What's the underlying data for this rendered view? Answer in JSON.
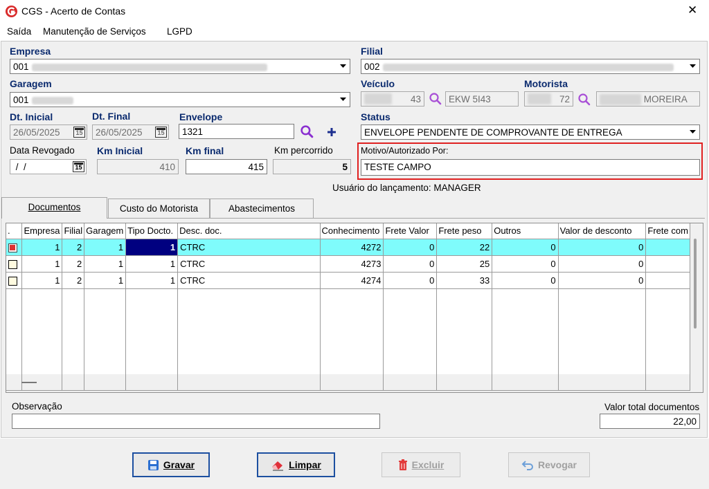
{
  "window": {
    "title": "CGS - Acerto de Contas"
  },
  "menu": [
    "Saída",
    "Manutenção de Serviços",
    "LGPD"
  ],
  "form": {
    "empresa_label": "Empresa",
    "empresa_value": "001",
    "filial_label": "Filial",
    "filial_value": "002",
    "garagem_label": "Garagem",
    "garagem_value": "001",
    "veiculo_label": "Veículo",
    "veiculo_code": "43",
    "veiculo_plate": "EKW 5I43",
    "motorista_label": "Motorista",
    "motorista_code": "72",
    "motorista_name": "MOREIRA",
    "dt_inicial_label": "Dt. Inicial",
    "dt_inicial_value": "26/05/2025",
    "dt_final_label": "Dt. Final",
    "dt_final_value": "26/05/2025",
    "envelope_label": "Envelope",
    "envelope_value": "1321",
    "status_label": "Status",
    "status_value": "ENVELOPE PENDENTE DE COMPROVANTE DE ENTREGA",
    "data_revogado_label": "Data Revogado",
    "data_revogado_value": " /  /",
    "km_inicial_label": "Km Inicial",
    "km_inicial_value": "410",
    "km_final_label": "Km final",
    "km_final_value": "415",
    "km_percorrido_label": "Km percorrido",
    "km_percorrido_value": "5",
    "motivo_label": "Motivo/Autorizado Por:",
    "motivo_value": "TESTE CAMPO",
    "usuario_text": "Usuário do lançamento: MANAGER",
    "calendar_icon_text": "15"
  },
  "tabs": [
    "Documentos",
    "Custo do Motorista",
    "Abastecimentos"
  ],
  "grid": {
    "headers": [
      ".",
      "Empresa",
      "Filial",
      "Garagem",
      "Tipo Docto.",
      "Desc. doc.",
      "Conhecimento",
      "Frete Valor",
      "Frete peso",
      "Outros",
      "Valor de desconto",
      "Frete com"
    ],
    "rows": [
      {
        "checked": true,
        "cells": [
          "1",
          "2",
          "1",
          "1",
          "CTRC",
          "4272",
          "0",
          "22",
          "0",
          "0",
          ""
        ]
      },
      {
        "checked": false,
        "cells": [
          "1",
          "2",
          "1",
          "1",
          "CTRC",
          "4273",
          "0",
          "25",
          "0",
          "0",
          ""
        ]
      },
      {
        "checked": false,
        "cells": [
          "1",
          "2",
          "1",
          "1",
          "CTRC",
          "4274",
          "0",
          "33",
          "0",
          "0",
          ""
        ]
      }
    ]
  },
  "footer": {
    "observacao_label": "Observação",
    "observacao_value": "",
    "valor_total_label": "Valor total documentos",
    "valor_total_value": "22,00"
  },
  "buttons": {
    "gravar": "Gravar",
    "limpar": "Limpar",
    "excluir": "Excluir",
    "revogar": "Revogar"
  },
  "colors": {
    "label_blue": "#0a2a6e",
    "selected_row": "#7ffcfc",
    "highlight_cell": "#000080",
    "focus_border": "#e02020"
  }
}
